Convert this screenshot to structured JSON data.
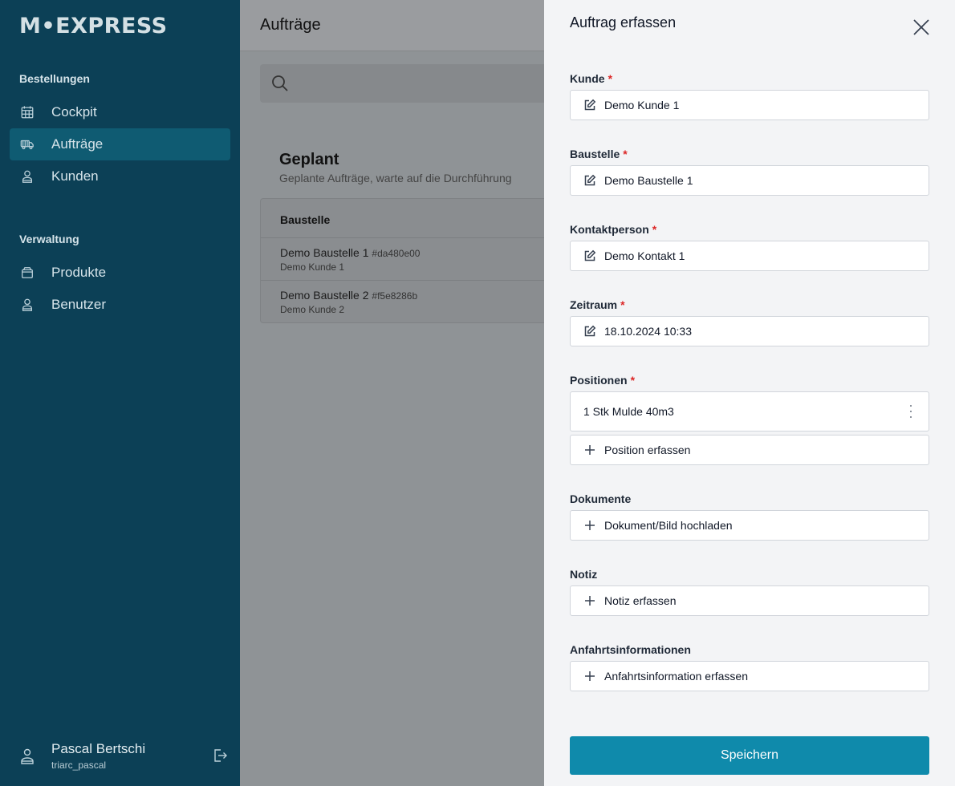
{
  "app": {
    "logo": "M•EXPRESS"
  },
  "sidebar": {
    "sections": [
      {
        "title": "Bestellungen"
      },
      {
        "title": "Verwaltung"
      }
    ],
    "items": [
      {
        "label": "Cockpit"
      },
      {
        "label": "Aufträge"
      },
      {
        "label": "Kunden"
      },
      {
        "label": "Produkte"
      },
      {
        "label": "Benutzer"
      }
    ],
    "user": {
      "name": "Pascal Bertschi",
      "login": "triarc_pascal"
    }
  },
  "main": {
    "title": "Aufträge",
    "card": {
      "title": "Geplant",
      "subtitle": "Geplante Aufträge, warte auf die Durchführung",
      "column": "Baustelle",
      "rows": [
        {
          "name": "Demo Baustelle 1",
          "hash": "#da480e00",
          "customer": "Demo Kunde 1"
        },
        {
          "name": "Demo Baustelle 2",
          "hash": "#f5e8286b",
          "customer": "Demo Kunde 2"
        }
      ]
    }
  },
  "drawer": {
    "title": "Auftrag erfassen",
    "fields": {
      "kunde": {
        "label": "Kunde",
        "value": "Demo Kunde 1"
      },
      "baustelle": {
        "label": "Baustelle",
        "value": "Demo Baustelle 1"
      },
      "kontakt": {
        "label": "Kontaktperson",
        "value": "Demo Kontakt 1"
      },
      "zeitraum": {
        "label": "Zeitraum",
        "value": "18.10.2024 10:33"
      },
      "positionen": {
        "label": "Positionen",
        "item": "1 Stk Mulde 40m3",
        "add": "Position erfassen"
      },
      "dokumente": {
        "label": "Dokumente",
        "add": "Dokument/Bild hochladen"
      },
      "notiz": {
        "label": "Notiz",
        "add": "Notiz erfassen"
      },
      "anfahrt": {
        "label": "Anfahrtsinformationen",
        "add": "Anfahrtsinformation erfassen"
      }
    },
    "required_mark": "*",
    "save_label": "Speichern"
  },
  "colors": {
    "sidebar": "#0c4056",
    "active": "#0f5b72",
    "primary": "#0f8aab",
    "required": "#dc2626"
  }
}
